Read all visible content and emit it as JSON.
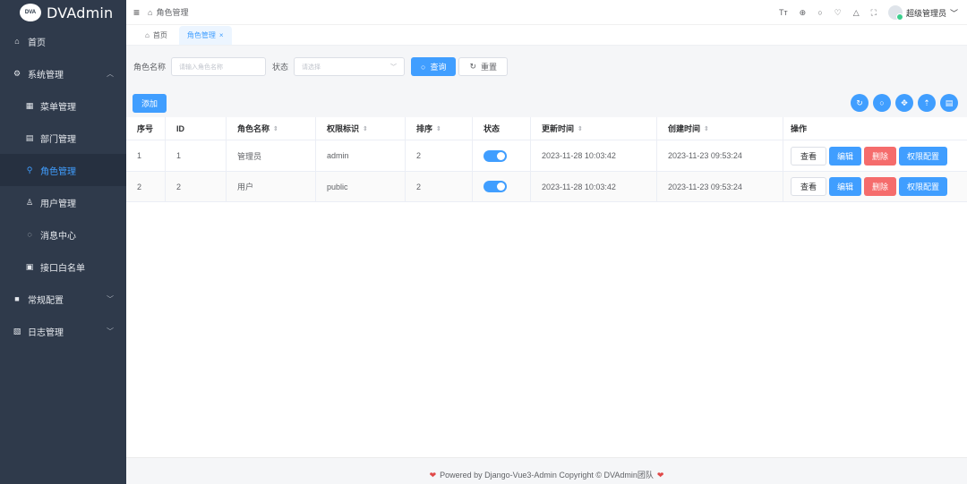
{
  "app": {
    "logo_text": "DVAdmin",
    "logo_badge": "DVA"
  },
  "sidebar": {
    "items": [
      {
        "label": "首页",
        "icon": "home-icon"
      },
      {
        "label": "系统管理",
        "icon": "gear-icon",
        "expanded": true
      },
      {
        "label": "菜单管理",
        "icon": "grid-icon"
      },
      {
        "label": "部门管理",
        "icon": "building-icon"
      },
      {
        "label": "角色管理",
        "icon": "role-icon",
        "active": true
      },
      {
        "label": "用户管理",
        "icon": "user-icon"
      },
      {
        "label": "消息中心",
        "icon": "chat-icon"
      },
      {
        "label": "接口白名单",
        "icon": "whitelist-icon"
      },
      {
        "label": "常规配置",
        "icon": "config-icon",
        "expanded": false
      },
      {
        "label": "日志管理",
        "icon": "log-icon",
        "expanded": false
      }
    ]
  },
  "header": {
    "breadcrumb": "角色管理",
    "user_name": "超级管理员"
  },
  "tabs": [
    {
      "label": "首页"
    },
    {
      "label": "角色管理",
      "active": true
    }
  ],
  "search": {
    "role_name_label": "角色名称",
    "role_name_placeholder": "请输入角色名称",
    "status_label": "状态",
    "status_placeholder": "请选择",
    "query_label": "查询",
    "reset_label": "重置"
  },
  "toolbar": {
    "add_label": "添加"
  },
  "table": {
    "columns": [
      "序号",
      "ID",
      "角色名称",
      "权限标识",
      "排序",
      "状态",
      "更新时间",
      "创建时间",
      "操作"
    ],
    "rows": [
      {
        "index": "1",
        "id": "1",
        "name": "管理员",
        "key": "admin",
        "sort": "2",
        "status": true,
        "updated": "2023-11-28 10:03:42",
        "created": "2023-11-23 09:53:24"
      },
      {
        "index": "2",
        "id": "2",
        "name": "用户",
        "key": "public",
        "sort": "2",
        "status": true,
        "updated": "2023-11-28 10:03:42",
        "created": "2023-11-23 09:53:24"
      }
    ],
    "actions": {
      "view": "查看",
      "edit": "编辑",
      "delete": "删除",
      "perm": "权限配置"
    }
  },
  "footer": {
    "text": "Powered by Django-Vue3-Admin Copyright © DVAdmin团队"
  },
  "colors": {
    "primary": "#409eff",
    "danger": "#f56c6c",
    "sidebar": "#2f3a4b"
  }
}
